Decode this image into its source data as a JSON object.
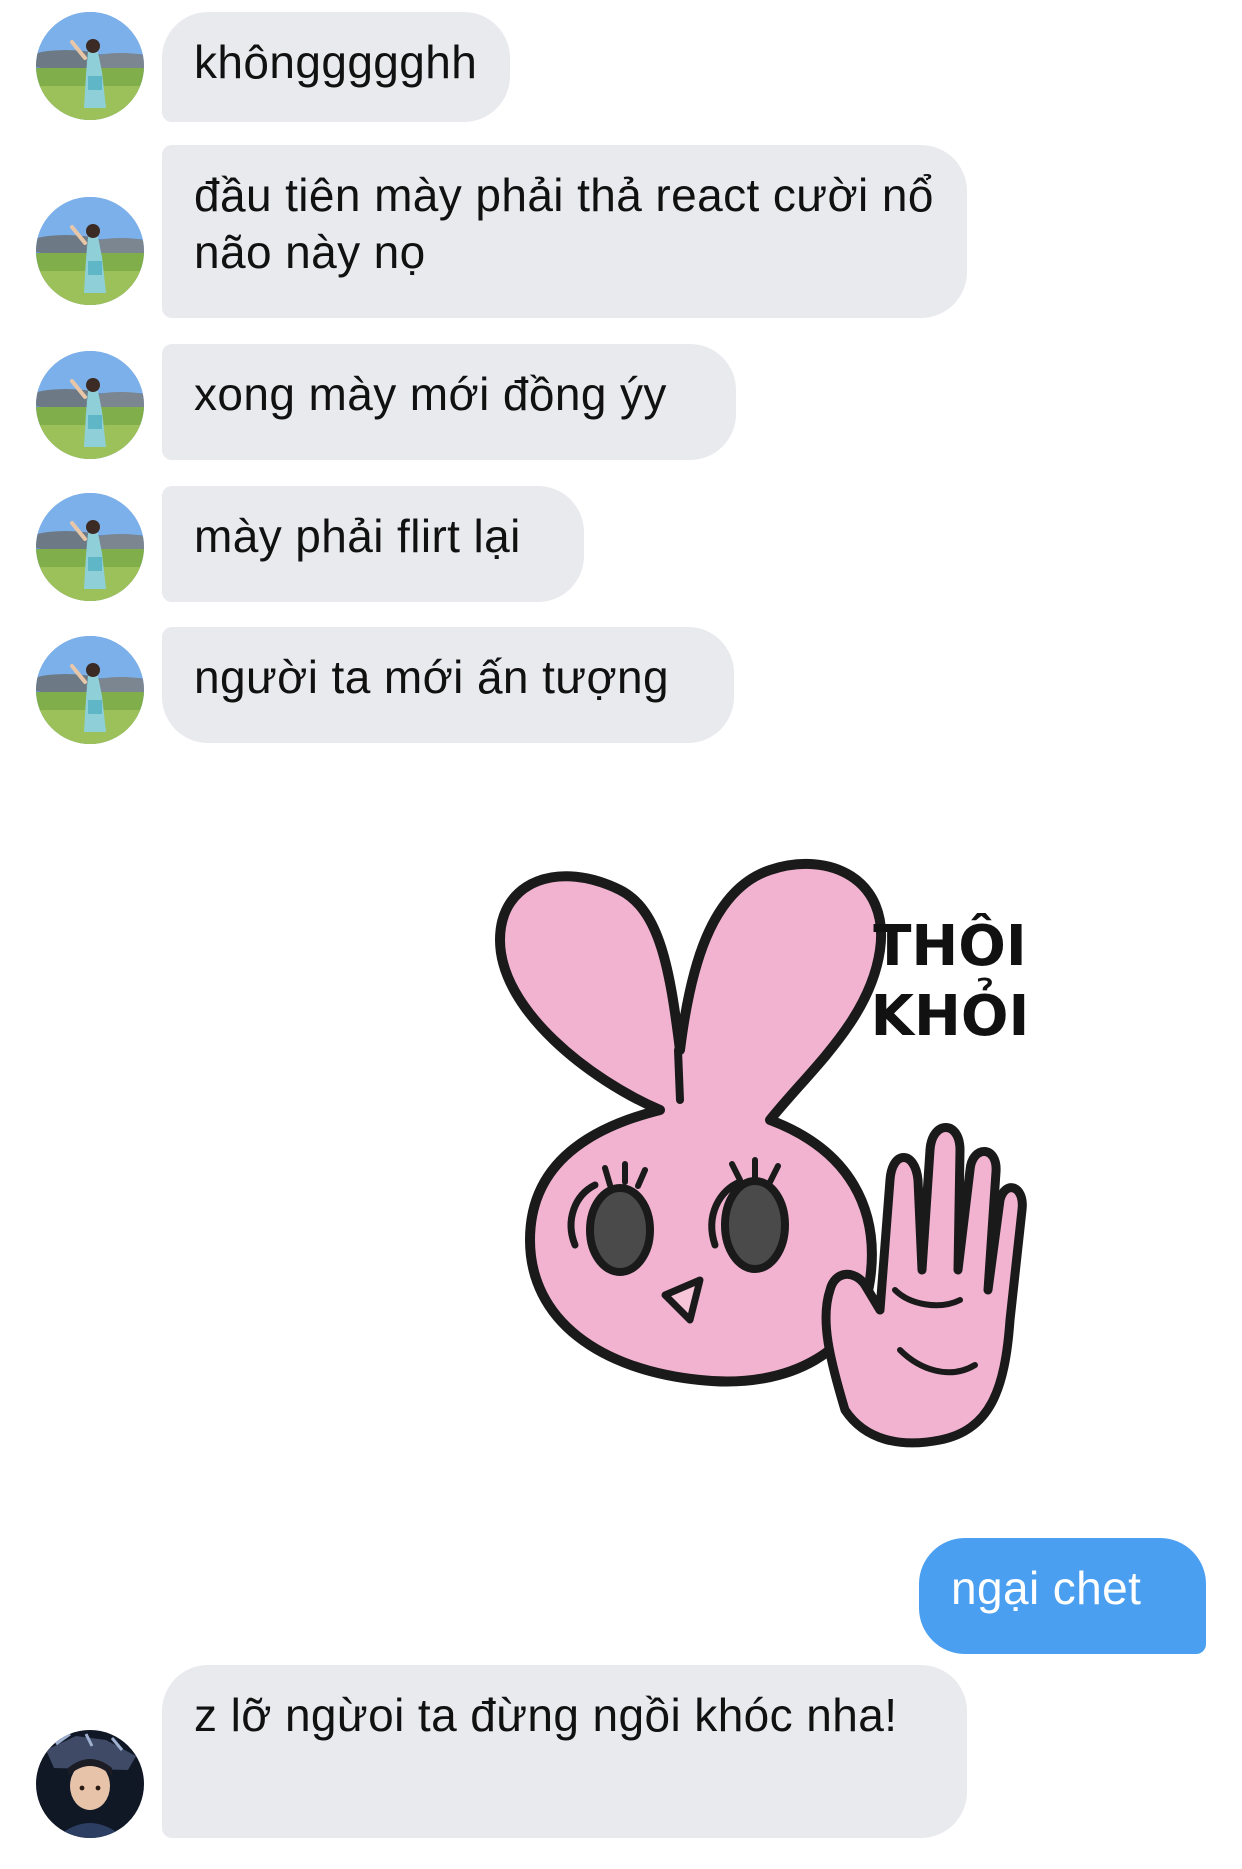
{
  "conversation": {
    "incoming_group_1": [
      {
        "text": "khônggggghh"
      },
      {
        "text": "đầu tiên mày phải thả react cười nổ não này nọ"
      },
      {
        "text": "xong mày mới đồng ýy"
      },
      {
        "text": "mày phải flirt lại"
      },
      {
        "text": "người ta mới ấn tượng"
      }
    ],
    "sticker": {
      "text_line_1": "THÔI",
      "text_line_2": "KHỎI",
      "icon": "pink-bunny-stop-hand-sticker"
    },
    "outgoing": [
      {
        "text": "ngại chet"
      }
    ],
    "incoming_group_2": [
      {
        "text": "z lỡ ngừoi ta đừng ngồi khóc nha!"
      }
    ]
  },
  "colors": {
    "incoming_bubble": "#e9eaee",
    "outgoing_bubble": "#4a9ff1",
    "sticker_pink": "#f2b3d0"
  },
  "avatars": {
    "friend_1": "landscape-avatar-icon",
    "friend_2": "dark-portrait-avatar-icon"
  }
}
